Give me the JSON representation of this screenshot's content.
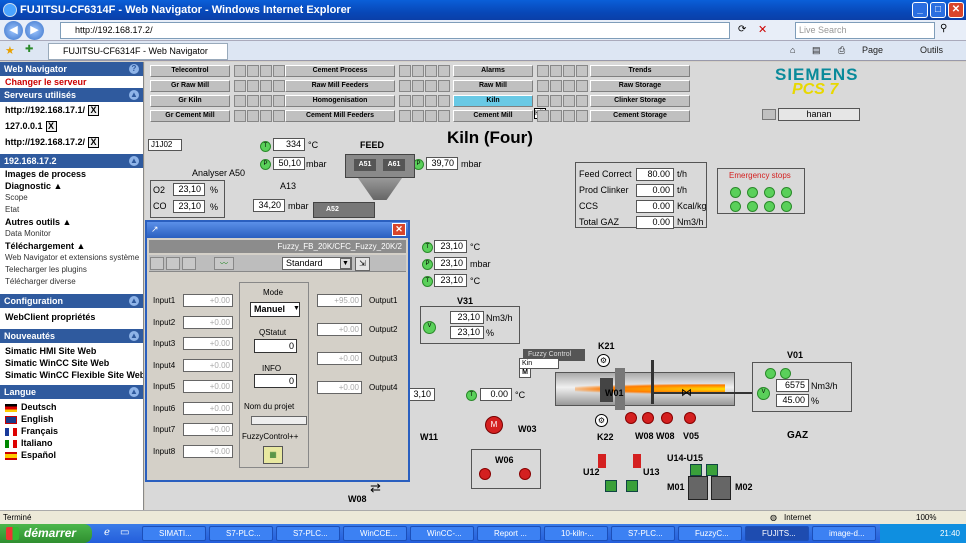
{
  "window": {
    "title": "FUJITSU-CF6314F - Web Navigator - Windows Internet Explorer"
  },
  "browser": {
    "address": "http://192.168.17.2/",
    "search_placeholder": "Live Search",
    "tab_title": "FUJITSU-CF6314F - Web Navigator",
    "tools": {
      "page": "Page",
      "tools": "Outils"
    }
  },
  "sidebar": {
    "web_navigator": "Web Navigator",
    "change_server": "Changer le serveur",
    "servers_header": "Serveurs utilisés",
    "servers": [
      "http://192.168.17.1/",
      "127.0.0.1",
      "http://192.168.17.2/"
    ],
    "section_ip": "192.168.17.2",
    "items": [
      {
        "label": "Images de process",
        "style": "b"
      },
      {
        "label": "Diagnostic ▲",
        "style": "b"
      },
      {
        "label": "Scope",
        "style": "sm"
      },
      {
        "label": "Etat",
        "style": "sm"
      },
      {
        "label": "Autres outils ▲",
        "style": "b"
      },
      {
        "label": "Data Monitor",
        "style": "sm"
      },
      {
        "label": "Téléchargement ▲",
        "style": "b"
      },
      {
        "label": "Web Navigator et extensions système",
        "style": "sm"
      },
      {
        "label": "Telecharger les plugins",
        "style": "sm"
      },
      {
        "label": "Télécharger diverse",
        "style": "sm"
      }
    ],
    "config_header": "Configuration",
    "config_item": "WebClient propriétés",
    "news_header": "Nouveautés",
    "news": [
      "Simatic HMI Site Web",
      "Simatic WinCC Site Web",
      "Simatic WinCC Flexible Site Web"
    ],
    "lang_header": "Langue",
    "languages": [
      "Deutsch",
      "English",
      "Français",
      "Italiano",
      "Español"
    ]
  },
  "nav": {
    "row1": [
      "Telecontrol",
      "Cement Process",
      "Alarms",
      "Trends"
    ],
    "row2": [
      "Gr Raw Mill",
      "Raw Mill Feeders",
      "Raw Mill",
      "Raw Storage"
    ],
    "row3": [
      "Gr Kiln",
      "Homogenisation",
      "Kiln",
      "Clinker Storage"
    ],
    "row4": [
      "Gr Cement Mill",
      "Cement Mill Feeders",
      "Cement Mill",
      "Cement Storage"
    ],
    "tooltip": "Kiln",
    "user": "hanan"
  },
  "brand": {
    "name": "SIEMENS",
    "product": "PCS 7"
  },
  "plant": {
    "title": "Kiln (Four)",
    "tag": "J1J02",
    "feed": "FEED",
    "analyser": "Analyser A50",
    "a13": "A13",
    "a51": "A51",
    "a61": "A61",
    "a52": "A52",
    "temp1": {
      "value": "334",
      "unit": "°C"
    },
    "press1": {
      "value": "50,10",
      "unit": "mbar"
    },
    "press2": {
      "value": "39,70",
      "unit": "mbar"
    },
    "press3": {
      "value": "34,20",
      "unit": "mbar"
    },
    "o2": {
      "label": "O2",
      "value": "23,10",
      "unit": "%"
    },
    "co": {
      "label": "CO",
      "value": "23,10",
      "unit": "%"
    },
    "right_vals": [
      {
        "value": "23,10",
        "unit": "°C"
      },
      {
        "value": "23,10",
        "unit": "mbar"
      },
      {
        "value": "23,10",
        "unit": "°C"
      }
    ],
    "v31": {
      "label": "V31",
      "flow": "23,10",
      "flow_unit": "Nm3/h",
      "pct": "23,10",
      "pct_unit": "%"
    },
    "kiln_temp": {
      "value": "0.00",
      "unit": "°C"
    },
    "kiln_left": "3,10",
    "fuzzy_label": "Fuzzy Control",
    "kiln_mode": "Kin",
    "k21": "K21",
    "w01": "W01",
    "k22": "K22",
    "w08a": "W08",
    "w08b": "W08",
    "v05": "V05",
    "w11": "W11",
    "w03": "W03",
    "w06": "W06",
    "w08c": "W08",
    "u12": "U12",
    "u13": "U13",
    "u1415": "U14-U15",
    "m01": "M01",
    "m02": "M02",
    "v01": {
      "label": "V01",
      "flow": "6575",
      "flow_unit": "Nm3/h",
      "pct": "45.00",
      "pct_unit": "%"
    },
    "gaz": "GAZ",
    "summary": [
      {
        "label": "Feed Correct",
        "value": "80.00",
        "unit": "t/h"
      },
      {
        "label": "Prod Clinker",
        "value": "0.00",
        "unit": "t/h"
      },
      {
        "label": "CCS",
        "value": "0.00",
        "unit": "Kcal/kg"
      },
      {
        "label": "Total GAZ",
        "value": "0.00",
        "unit": "Nm3/h"
      }
    ],
    "emergency": "Emergency stops"
  },
  "dialog": {
    "path": "Fuzzy_FB_20K/CFC_Fuzzy_20K/2",
    "view": "Standard",
    "inputs": [
      "Input1",
      "Input2",
      "Input3",
      "Input4",
      "Input5",
      "Input6",
      "Input7",
      "Input8"
    ],
    "input_value": "+0.00",
    "outputs": [
      "Output1",
      "Output2",
      "Output3",
      "Output4"
    ],
    "output_values": [
      "+95.00",
      "+0.00",
      "+0.00",
      "+0.00"
    ],
    "mode_label": "Mode",
    "mode_value": "Manuel",
    "qstatut_label": "QStatut",
    "qstatut_value": "0",
    "info_label": "INFO",
    "info_value": "0",
    "project_label": "Nom du projet",
    "footer": "FuzzyControl++"
  },
  "status": {
    "left": "Terminé",
    "zone": "Internet",
    "zoom": "100%"
  },
  "taskbar": {
    "start": "démarrer",
    "tasks": [
      "SIMATI...",
      "S7-PLC...",
      "S7-PLC...",
      "WinCCE...",
      "WinCC-...",
      "Report ...",
      "10-kiln-...",
      "S7-PLC...",
      "FuzzyC...",
      "FUJITS...",
      "image-d..."
    ],
    "clock": "21:40"
  }
}
